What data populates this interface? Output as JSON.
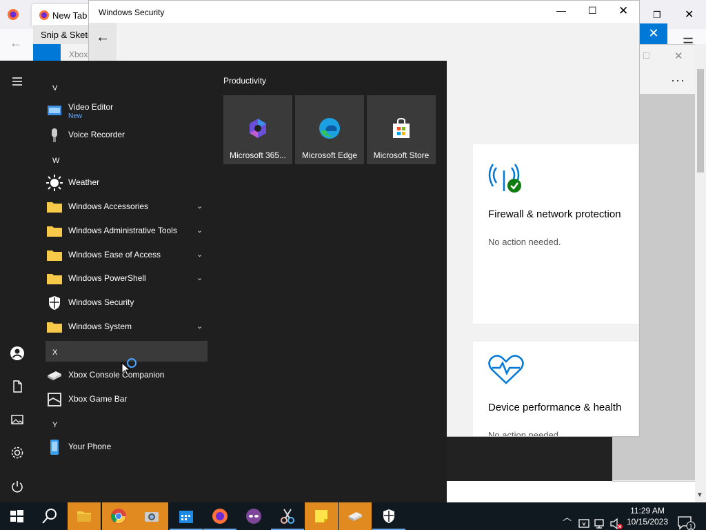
{
  "firefox": {
    "tab_title": "New Tab"
  },
  "snip": {
    "title": "Snip & Sketch",
    "behind_text": "Xbox"
  },
  "windows_security": {
    "title": "Windows Security",
    "cards": [
      {
        "title": "Firewall & network protection",
        "status": "No action needed."
      },
      {
        "title": "Device performance & health",
        "status": "No action needed."
      }
    ]
  },
  "start_menu": {
    "letters": [
      "V",
      "W",
      "X",
      "Y"
    ],
    "apps": [
      {
        "label": "Video Editor",
        "badge": "New",
        "icon": "video-editor-icon"
      },
      {
        "label": "Voice Recorder",
        "icon": "microphone-icon"
      },
      {
        "label": "Weather",
        "icon": "sun-icon"
      },
      {
        "label": "Windows Accessories",
        "icon": "folder-icon",
        "expandable": true
      },
      {
        "label": "Windows Administrative Tools",
        "icon": "folder-icon",
        "expandable": true
      },
      {
        "label": "Windows Ease of Access",
        "icon": "folder-icon",
        "expandable": true
      },
      {
        "label": "Windows PowerShell",
        "icon": "folder-icon",
        "expandable": true
      },
      {
        "label": "Windows Security",
        "icon": "shield-icon"
      },
      {
        "label": "Windows System",
        "icon": "folder-icon",
        "expandable": true
      },
      {
        "label": "Xbox Console Companion",
        "icon": "xbox-console-icon"
      },
      {
        "label": "Xbox Game Bar",
        "icon": "xbox-game-bar-icon"
      },
      {
        "label": "Your Phone",
        "icon": "phone-icon"
      }
    ],
    "tiles_group": "Productivity",
    "tiles": [
      {
        "label": "Microsoft 365...",
        "icon": "office-icon"
      },
      {
        "label": "Microsoft Edge",
        "icon": "edge-icon"
      },
      {
        "label": "Microsoft Store",
        "icon": "store-icon"
      }
    ]
  },
  "taskbar": {
    "time": "11:29 AM",
    "date": "10/15/2023",
    "notification_count": "1"
  },
  "colors": {
    "accent": "#0078d7",
    "start_bg": "#1f1f1f",
    "taskbar_bg": "#101820",
    "active_task": "#e08a20"
  }
}
